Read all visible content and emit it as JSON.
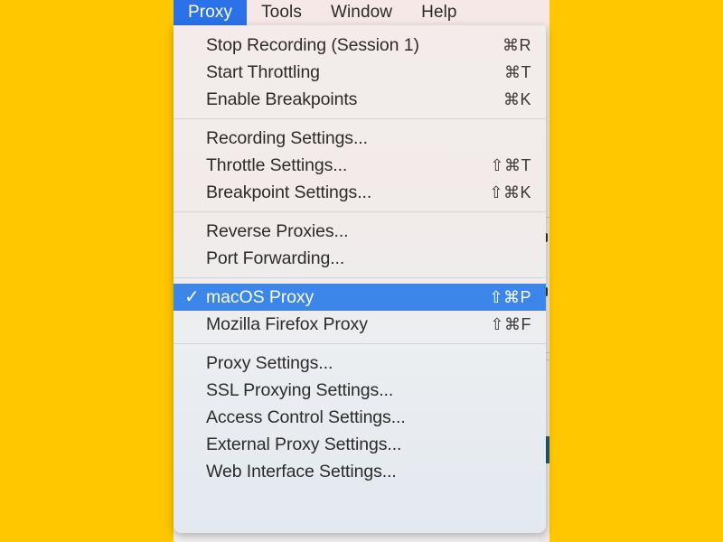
{
  "background": {
    "desktop_color": "#FFC700",
    "window_color": "#f2f0f0"
  },
  "menubar": {
    "items": [
      {
        "label": "Proxy",
        "active": true
      },
      {
        "label": "Tools",
        "active": false
      },
      {
        "label": "Window",
        "active": false
      },
      {
        "label": "Help",
        "active": false
      }
    ]
  },
  "menu": {
    "accent_color": "#3b86e8",
    "groups": [
      {
        "items": [
          {
            "label": "Stop Recording (Session 1)",
            "shortcut": "⌘R",
            "checked": false,
            "selected": false
          },
          {
            "label": "Start Throttling",
            "shortcut": "⌘T",
            "checked": false,
            "selected": false
          },
          {
            "label": "Enable Breakpoints",
            "shortcut": "⌘K",
            "checked": false,
            "selected": false
          }
        ]
      },
      {
        "items": [
          {
            "label": "Recording Settings...",
            "shortcut": "",
            "checked": false,
            "selected": false
          },
          {
            "label": "Throttle Settings...",
            "shortcut": "⇧⌘T",
            "checked": false,
            "selected": false
          },
          {
            "label": "Breakpoint Settings...",
            "shortcut": "⇧⌘K",
            "checked": false,
            "selected": false
          }
        ]
      },
      {
        "items": [
          {
            "label": "Reverse Proxies...",
            "shortcut": "",
            "checked": false,
            "selected": false
          },
          {
            "label": "Port Forwarding...",
            "shortcut": "",
            "checked": false,
            "selected": false
          }
        ]
      },
      {
        "items": [
          {
            "label": "macOS Proxy",
            "shortcut": "⇧⌘P",
            "checked": true,
            "selected": true
          },
          {
            "label": "Mozilla Firefox Proxy",
            "shortcut": "⇧⌘F",
            "checked": false,
            "selected": false
          }
        ]
      },
      {
        "items": [
          {
            "label": "Proxy Settings...",
            "shortcut": "",
            "checked": false,
            "selected": false
          },
          {
            "label": "SSL Proxying Settings...",
            "shortcut": "",
            "checked": false,
            "selected": false
          },
          {
            "label": "Access Control Settings...",
            "shortcut": "",
            "checked": false,
            "selected": false
          },
          {
            "label": "External Proxy Settings...",
            "shortcut": "",
            "checked": false,
            "selected": false
          },
          {
            "label": "Web Interface Settings...",
            "shortcut": "",
            "checked": false,
            "selected": false
          }
        ]
      }
    ],
    "check_glyph": "✓"
  }
}
